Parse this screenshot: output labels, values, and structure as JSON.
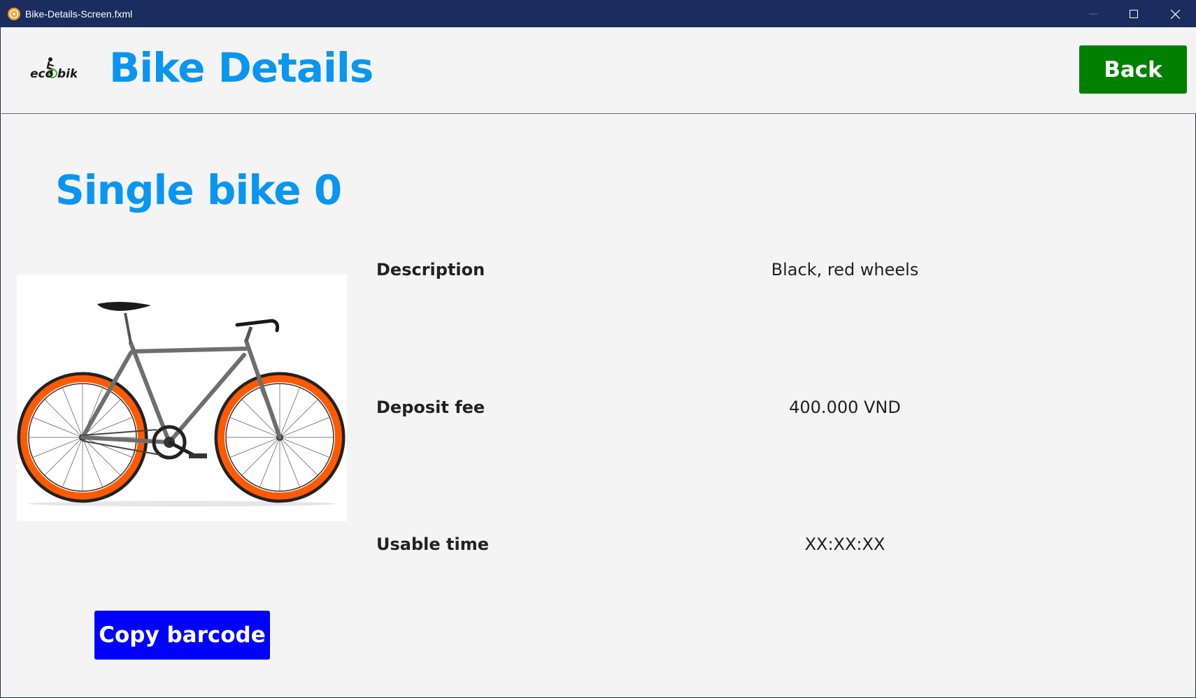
{
  "window": {
    "title": "Bike-Details-Screen.fxml",
    "app_icon": "app-icon",
    "controls": [
      "minimize-icon",
      "maximize-icon",
      "close-icon"
    ]
  },
  "header": {
    "logo_text": "ecobike",
    "title": "Bike Details",
    "back_label": "Back"
  },
  "bike": {
    "name": "Single bike 0",
    "image": "bicycle-image",
    "copy_barcode_label": "Copy barcode"
  },
  "details": [
    {
      "label": "Description",
      "value": "Black, red wheels"
    },
    {
      "label": "Deposit fee",
      "value": "400.000 VND"
    },
    {
      "label": "Usable time",
      "value": "XX:XX:XX"
    }
  ],
  "colors": {
    "titlebar": "#1b2d5e",
    "title_blue": "#0a96f0",
    "back_green": "#008000",
    "copy_blue": "#0000ff",
    "tire_orange": "#ff5a00"
  }
}
